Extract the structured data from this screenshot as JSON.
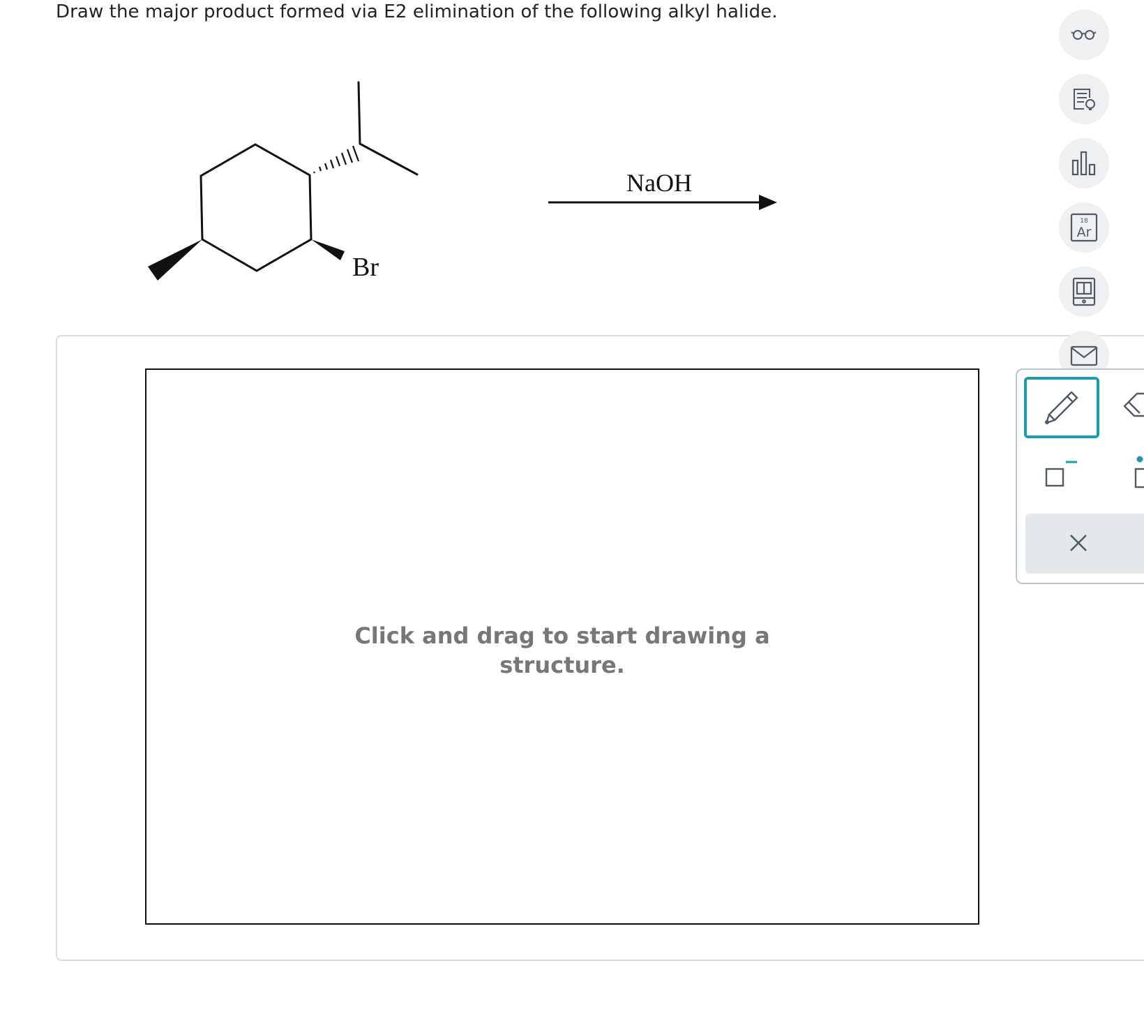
{
  "question": {
    "text": "Draw the major product formed via E2 elimination of the following alkyl halide."
  },
  "reaction": {
    "substituent_label": "Br",
    "reagent": "NaOH"
  },
  "canvas": {
    "hint_line1": "Click and drag to start drawing a",
    "hint_line2": "structure."
  },
  "side_tools": [
    {
      "name": "glasses-icon"
    },
    {
      "name": "hint-document-icon"
    },
    {
      "name": "bar-chart-icon"
    },
    {
      "name": "periodic-table-icon",
      "number": "18",
      "symbol": "Ar"
    },
    {
      "name": "ebook-icon"
    },
    {
      "name": "mail-icon"
    }
  ],
  "colors": {
    "accent": "#1a9bb0",
    "icon": "#4e5b63",
    "hint_text": "#777777",
    "panel_border": "#d6dde2"
  }
}
